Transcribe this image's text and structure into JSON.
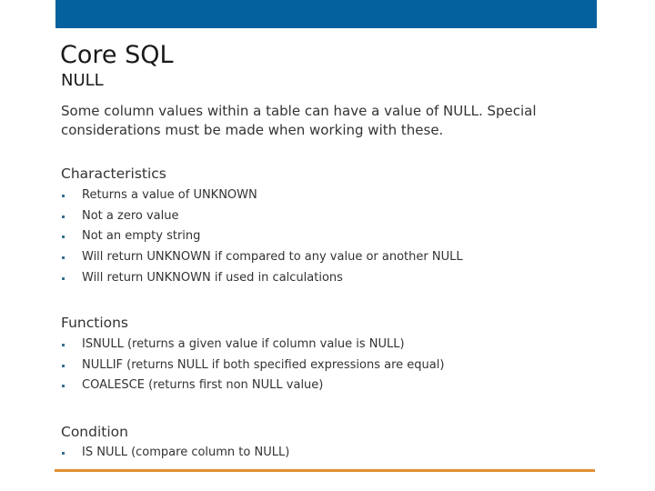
{
  "slide": {
    "title": "Core SQL",
    "subtitle": "NULL",
    "intro": "Some column values within a table can have a value of NULL.  Special considerations must be made when working with these.",
    "colors": {
      "header_bar": "#05609e",
      "bottom_rule": "#e08e33",
      "bullet": "#3a6f8f"
    }
  },
  "sections": [
    {
      "heading": "Characteristics",
      "items": [
        "Returns a value of UNKNOWN",
        "Not a zero value",
        "Not an empty string",
        "Will return UNKNOWN if compared to any value or another NULL",
        "Will return UNKNOWN if used in calculations"
      ]
    },
    {
      "heading": "Functions",
      "items": [
        "ISNULL (returns a given value if column value is NULL)",
        "NULLIF (returns NULL if both specified expressions are equal)",
        "COALESCE (returns first non NULL value)"
      ]
    },
    {
      "heading": "Condition",
      "items": [
        "IS NULL (compare column to NULL)"
      ]
    }
  ]
}
